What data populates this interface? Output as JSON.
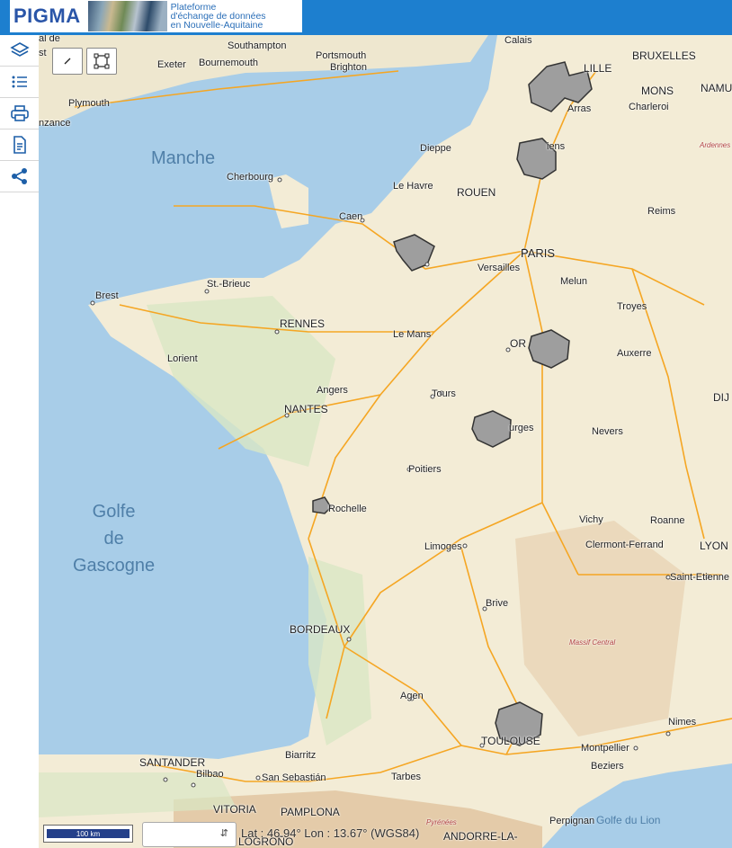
{
  "app": {
    "logo_text": "PIGMA",
    "subtitle_line1": "Plateforme",
    "subtitle_line2": "d'échange de données",
    "subtitle_line3": "en Nouvelle-Aquitaine"
  },
  "sidebar": {
    "buttons": [
      "layers-icon",
      "legend-list-icon",
      "print-icon",
      "document-icon",
      "share-icon"
    ]
  },
  "map": {
    "seas": {
      "manche": "Manche",
      "golfe_line1": "Golfe",
      "golfe_line2": "de",
      "golfe_line3": "Gascogne",
      "golfe_lion": "Golfe du Lion"
    },
    "labels": {
      "southampton": "Southampton",
      "portsmouth": "Portsmouth",
      "brighton": "Brighton",
      "exeter": "Exeter",
      "bournemouth": "Bournemouth",
      "plymouth": "Plymouth",
      "penzance": "nzance",
      "calais": "Calais",
      "lille": "LILLE",
      "bruxelles": "BRUXELLES",
      "mons": "MONS",
      "namur": "NAMU",
      "charleroi": "Charleroi",
      "arras": "Arras",
      "ardennes": "Ardennes",
      "dieppe": "Dieppe",
      "amiens": "iens",
      "cherbourg": "Cherbourg",
      "lehavre": "Le Havre",
      "rouen": "ROUEN",
      "caen": "Caen",
      "reims": "Reims",
      "paris": "PARIS",
      "versailles": "Versailles",
      "melun": "Melun",
      "troyes": "Troyes",
      "brest": "Brest",
      "stbrieuc": "St.-Brieuc",
      "rennes": "RENNES",
      "lemans": "Le Mans",
      "orleans": "OR",
      "auxerre": "Auxerre",
      "dijon": "DIJ",
      "lorient": "Lorient",
      "angers": "Angers",
      "tours": "Tours",
      "nantes": "NANTES",
      "bourges": "urges",
      "nevers": "Nevers",
      "poitiers": "Poitiers",
      "larochelle": "Rochelle",
      "vichy": "Vichy",
      "roanne": "Roanne",
      "clermont": "Clermont-Ferrand",
      "lyon": "LYON",
      "limoges": "Limoges",
      "stetienne": "Saint-Etienne",
      "brive": "Brive",
      "massif": "Massif Central",
      "bordeaux": "BORDEAUX",
      "agen": "Agen",
      "toulouse": "TOULOUSE",
      "nimes": "Nimes",
      "montpellier": "Montpellier",
      "beziers": "Beziers",
      "santander": "SANTANDER",
      "biarritz": "Biarritz",
      "bilbao": "Bilbao",
      "sansebastian": "San Sebastián",
      "tarbes": "Tarbes",
      "vitoria": "VITORIA",
      "pamplona": "PAMPLONA",
      "logrono": "LOGROÑO",
      "pyrenees": "Pyrénées",
      "andorre": "ANDORRE-LA-",
      "perpignan": "Perpignan",
      "topleft": "al de",
      "topleft2": "st"
    }
  },
  "scale": {
    "label": "100 km"
  },
  "projection_select": {
    "value": ""
  },
  "coords": {
    "text": "Lat : 46.94° Lon : 13.67° (WGS84)"
  },
  "colors": {
    "header": "#1d7fcf",
    "sea": "#a8cde8",
    "land": "#f3ecd6",
    "roads": "#f5a623",
    "highlight": "#9e9e9e"
  }
}
